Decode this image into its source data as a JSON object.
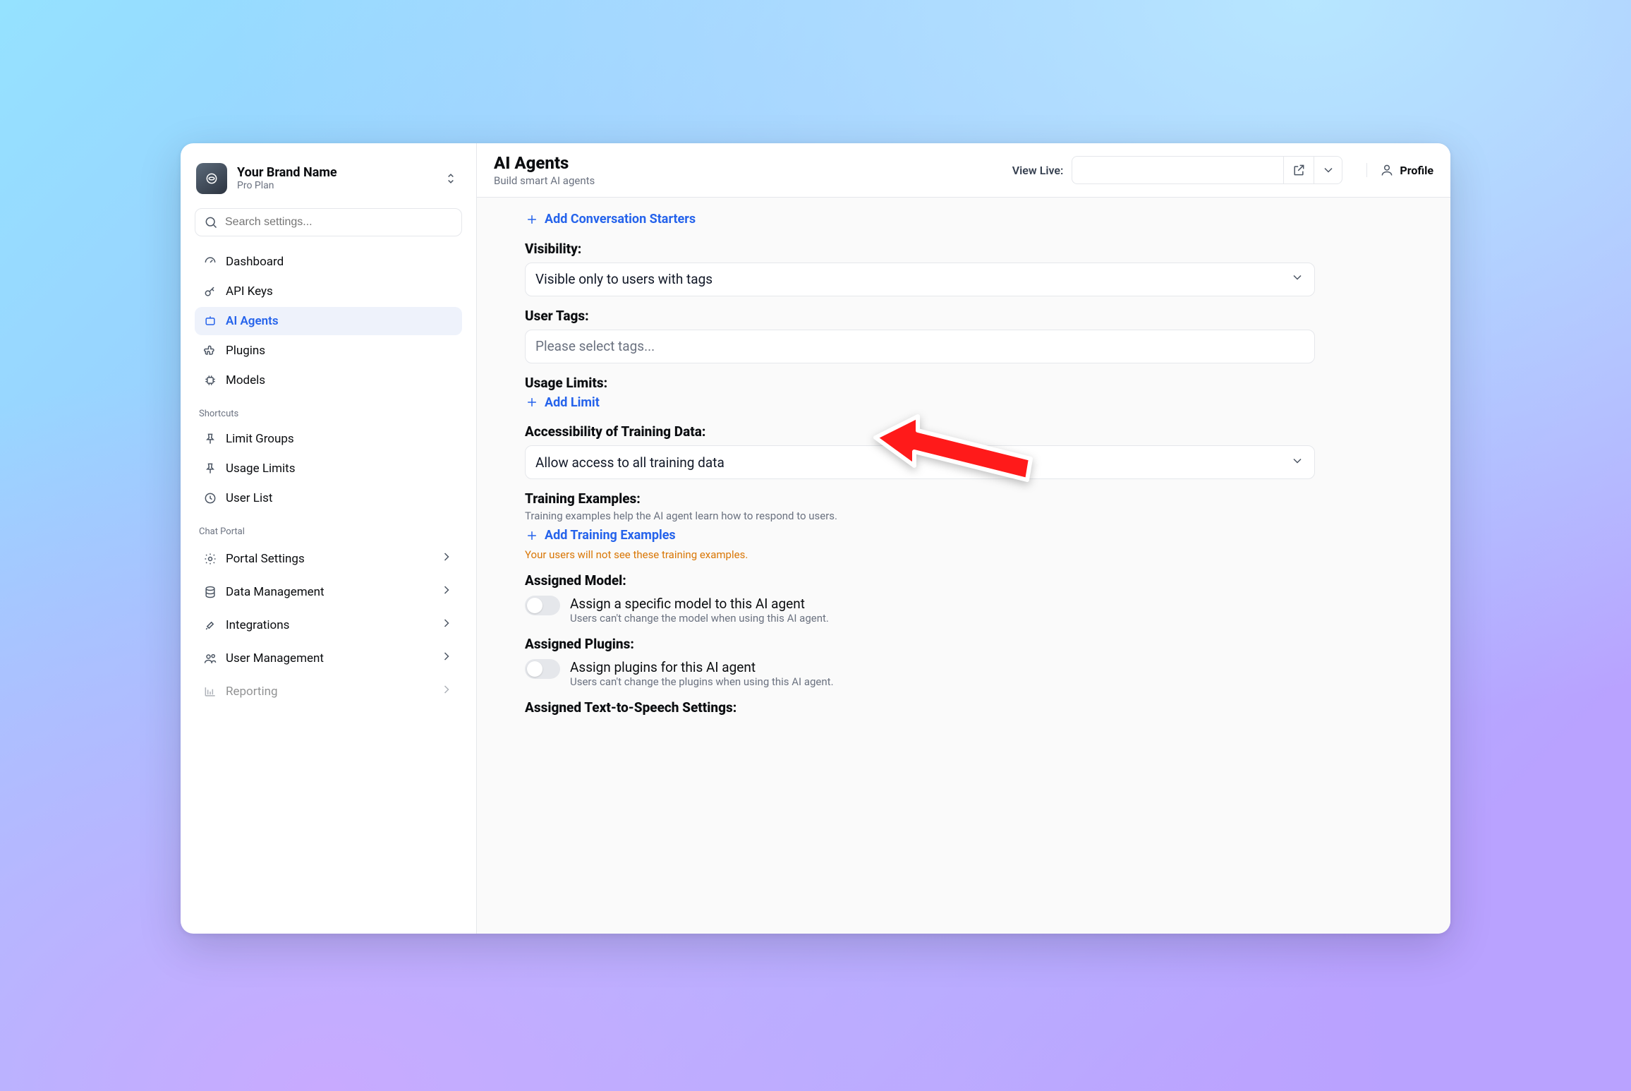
{
  "brand": {
    "name": "Your Brand Name",
    "plan": "Pro Plan"
  },
  "search": {
    "placeholder": "Search settings..."
  },
  "nav": {
    "primary": [
      {
        "label": "Dashboard"
      },
      {
        "label": "API Keys"
      },
      {
        "label": "AI Agents"
      },
      {
        "label": "Plugins"
      },
      {
        "label": "Models"
      }
    ],
    "sections": [
      {
        "title": "Shortcuts",
        "items": [
          {
            "label": "Limit Groups"
          },
          {
            "label": "Usage Limits"
          },
          {
            "label": "User List"
          }
        ]
      },
      {
        "title": "Chat Portal",
        "items": [
          {
            "label": "Portal Settings"
          },
          {
            "label": "Data Management"
          },
          {
            "label": "Integrations"
          },
          {
            "label": "User Management"
          },
          {
            "label": "Reporting"
          }
        ]
      }
    ]
  },
  "header": {
    "title": "AI Agents",
    "subtitle": "Build smart AI agents",
    "viewLiveLabel": "View Live:",
    "profile": "Profile"
  },
  "form": {
    "addConversationStarters": "Add Conversation Starters",
    "visibility": {
      "label": "Visibility:",
      "value": "Visible only to users with tags"
    },
    "userTags": {
      "label": "User Tags:",
      "placeholder": "Please select tags..."
    },
    "usageLimits": {
      "label": "Usage Limits:",
      "addLabel": "Add Limit"
    },
    "trainingAccess": {
      "label": "Accessibility of Training Data:",
      "value": "Allow access to all training data"
    },
    "trainingExamples": {
      "label": "Training Examples:",
      "helper": "Training examples help the AI agent learn how to respond to users.",
      "addLabel": "Add Training Examples",
      "note": "Your users will not see these training examples."
    },
    "assignedModel": {
      "label": "Assigned Model:",
      "title": "Assign a specific model to this AI agent",
      "sub": "Users can't change the model when using this AI agent.",
      "on": false
    },
    "assignedPlugins": {
      "label": "Assigned Plugins:",
      "title": "Assign plugins for this AI agent",
      "sub": "Users can't change the plugins when using this AI agent.",
      "on": false
    },
    "assignedTTS": {
      "label": "Assigned Text-to-Speech Settings:"
    }
  }
}
